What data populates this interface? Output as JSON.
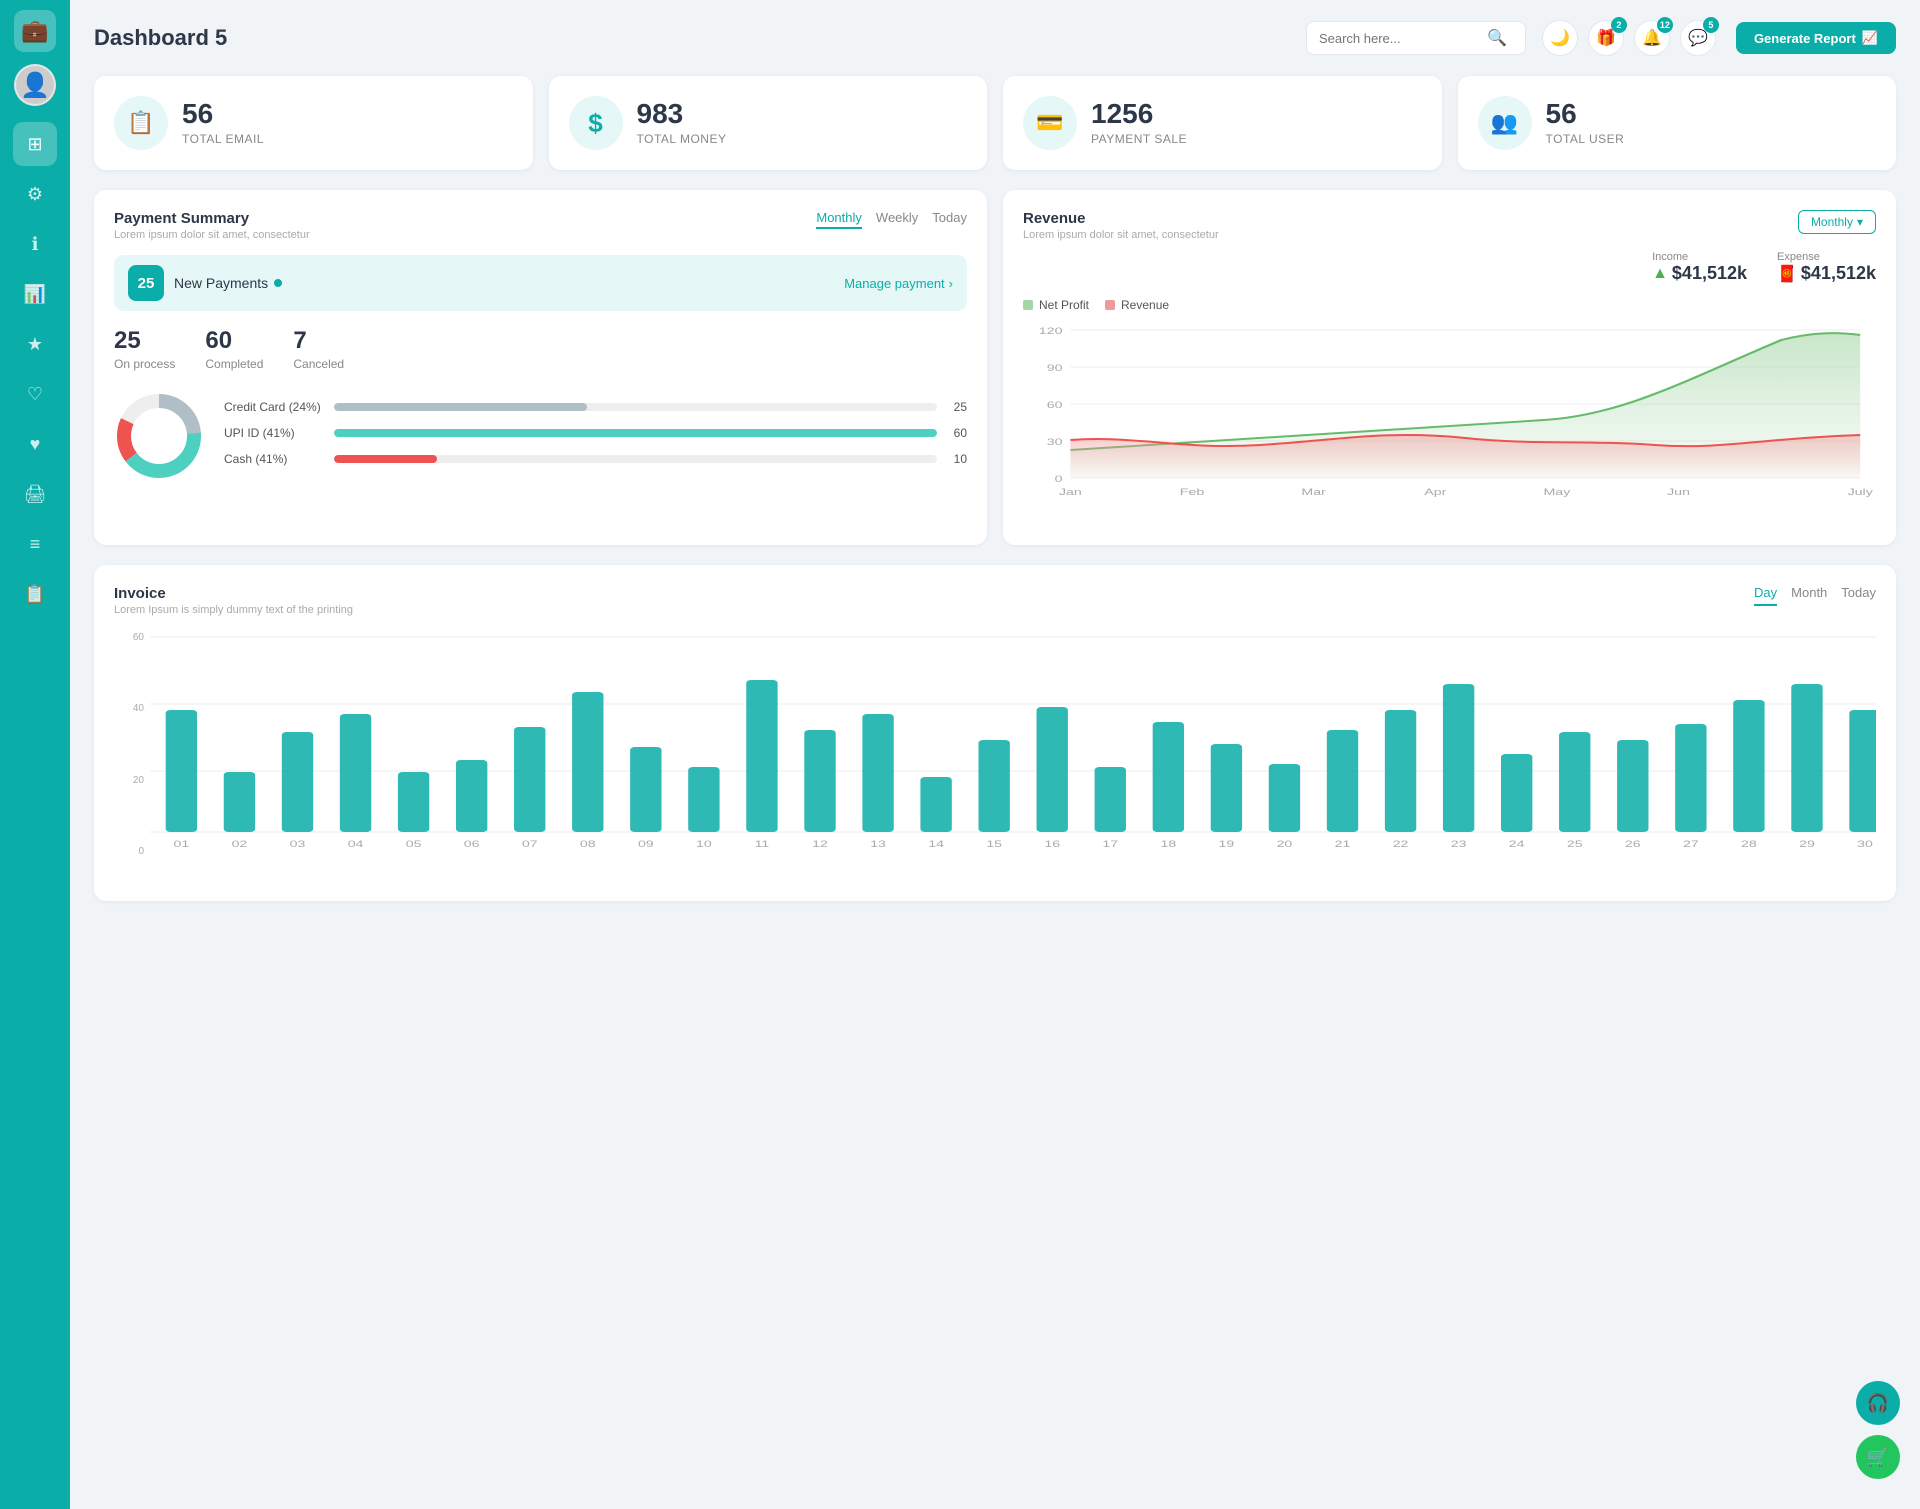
{
  "sidebar": {
    "logo_icon": "💼",
    "avatar_icon": "👤",
    "items": [
      {
        "id": "grid",
        "icon": "⊞",
        "active": true
      },
      {
        "id": "settings",
        "icon": "⚙"
      },
      {
        "id": "info",
        "icon": "ℹ"
      },
      {
        "id": "chart",
        "icon": "📊"
      },
      {
        "id": "star",
        "icon": "★"
      },
      {
        "id": "heart-outline",
        "icon": "♡"
      },
      {
        "id": "heart",
        "icon": "♥"
      },
      {
        "id": "printer",
        "icon": "🖨"
      },
      {
        "id": "list",
        "icon": "≡"
      },
      {
        "id": "doc",
        "icon": "📋"
      }
    ]
  },
  "header": {
    "title": "Dashboard 5",
    "search_placeholder": "Search here...",
    "generate_btn": "Generate Report",
    "badges": {
      "gift": "2",
      "bell": "12",
      "chat": "5"
    }
  },
  "stats": [
    {
      "id": "email",
      "icon": "📋",
      "number": "56",
      "label": "TOTAL EMAIL"
    },
    {
      "id": "money",
      "icon": "$",
      "number": "983",
      "label": "TOTAL MONEY"
    },
    {
      "id": "payment",
      "icon": "💳",
      "number": "1256",
      "label": "PAYMENT SALE"
    },
    {
      "id": "user",
      "icon": "👥",
      "number": "56",
      "label": "TOTAL USER"
    }
  ],
  "payment_summary": {
    "title": "Payment Summary",
    "subtitle": "Lorem ipsum dolor sit amet, consectetur",
    "tabs": [
      "Monthly",
      "Weekly",
      "Today"
    ],
    "active_tab": "Monthly",
    "new_payments_count": "25",
    "new_payments_label": "New Payments",
    "manage_link": "Manage payment",
    "on_process": "25",
    "on_process_label": "On process",
    "completed": "60",
    "completed_label": "Completed",
    "canceled": "7",
    "canceled_label": "Canceled",
    "progress_items": [
      {
        "label": "Credit Card (24%)",
        "value": 25,
        "max": 60,
        "color": "#b0bec5",
        "display": "25"
      },
      {
        "label": "UPI ID (41%)",
        "value": 60,
        "max": 60,
        "color": "#4dd0c0",
        "display": "60"
      },
      {
        "label": "Cash (41%)",
        "value": 10,
        "max": 60,
        "color": "#ef5350",
        "display": "10"
      }
    ]
  },
  "revenue": {
    "title": "Revenue",
    "subtitle": "Lorem ipsum dolor sit amet, consectetur",
    "active_tab": "Monthly",
    "income_label": "Income",
    "income_value": "$41,512k",
    "expense_label": "Expense",
    "expense_value": "$41,512k",
    "legend": [
      {
        "label": "Net Profit",
        "color": "#a5d6a7"
      },
      {
        "label": "Revenue",
        "color": "#ef9a9a"
      }
    ],
    "months": [
      "Jan",
      "Feb",
      "Mar",
      "Apr",
      "May",
      "Jun",
      "July"
    ],
    "y_labels": [
      "120",
      "90",
      "60",
      "30",
      "0"
    ]
  },
  "invoice": {
    "title": "Invoice",
    "subtitle": "Lorem Ipsum is simply dummy text of the printing",
    "tabs": [
      "Day",
      "Month",
      "Today"
    ],
    "active_tab": "Day",
    "y_labels": [
      "60",
      "40",
      "20",
      "0"
    ],
    "x_labels": [
      "01",
      "02",
      "03",
      "04",
      "05",
      "06",
      "07",
      "08",
      "09",
      "10",
      "11",
      "12",
      "13",
      "14",
      "15",
      "16",
      "17",
      "18",
      "19",
      "20",
      "21",
      "22",
      "23",
      "24",
      "25",
      "26",
      "27",
      "28",
      "29",
      "30"
    ],
    "bars": [
      35,
      12,
      25,
      30,
      12,
      18,
      28,
      38,
      20,
      14,
      42,
      25,
      30,
      10,
      22,
      33,
      14,
      28,
      20,
      15,
      25,
      32,
      42,
      18,
      25,
      22,
      28,
      36,
      42,
      35
    ]
  },
  "float_btns": [
    {
      "id": "headset",
      "icon": "🎧",
      "color": "#0aada8"
    },
    {
      "id": "cart",
      "icon": "🛒",
      "color": "#22c55e"
    }
  ]
}
